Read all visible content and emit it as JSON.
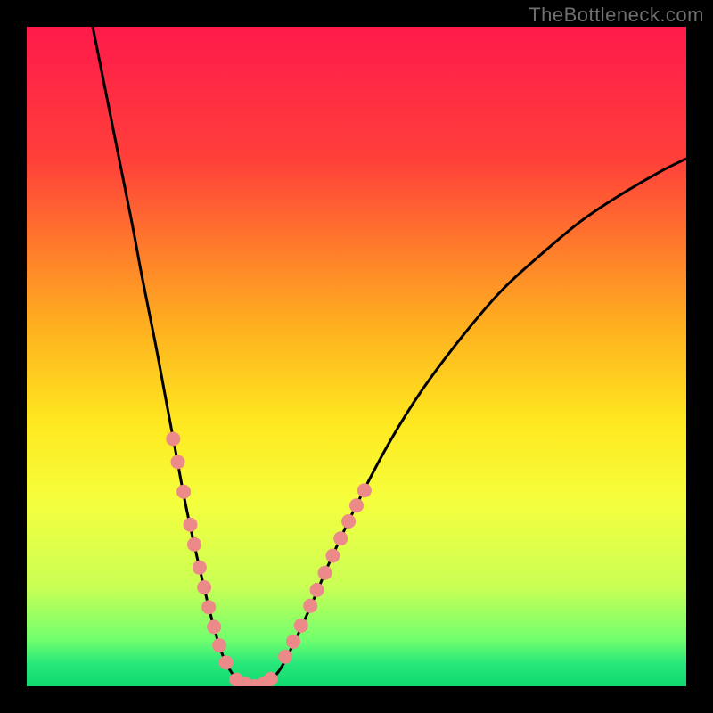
{
  "watermark": "TheBottleneck.com",
  "chart_data": {
    "type": "line",
    "title": "",
    "xlabel": "",
    "ylabel": "",
    "xlim": [
      0,
      100
    ],
    "ylim": [
      0,
      100
    ],
    "gradient_stops": [
      {
        "offset": 0.0,
        "color": "#ff1a4b"
      },
      {
        "offset": 0.2,
        "color": "#ff3f3a"
      },
      {
        "offset": 0.45,
        "color": "#ffae1f"
      },
      {
        "offset": 0.6,
        "color": "#ffe81f"
      },
      {
        "offset": 0.72,
        "color": "#f5ff3d"
      },
      {
        "offset": 0.85,
        "color": "#c9ff55"
      },
      {
        "offset": 0.93,
        "color": "#70ff6e"
      },
      {
        "offset": 0.965,
        "color": "#28e87a"
      },
      {
        "offset": 1.0,
        "color": "#0fd96f"
      }
    ],
    "series": [
      {
        "name": "left-curve",
        "type": "path",
        "points": [
          {
            "x": 10.0,
            "y": 100.0
          },
          {
            "x": 12.0,
            "y": 90.0
          },
          {
            "x": 14.0,
            "y": 80.0
          },
          {
            "x": 16.0,
            "y": 70.0
          },
          {
            "x": 17.5,
            "y": 62.0
          },
          {
            "x": 19.5,
            "y": 52.0
          },
          {
            "x": 21.0,
            "y": 44.0
          },
          {
            "x": 22.5,
            "y": 36.0
          },
          {
            "x": 24.0,
            "y": 28.0
          },
          {
            "x": 25.5,
            "y": 21.0
          },
          {
            "x": 27.0,
            "y": 14.5
          },
          {
            "x": 28.5,
            "y": 8.5
          },
          {
            "x": 30.0,
            "y": 4.0
          },
          {
            "x": 31.5,
            "y": 1.5
          },
          {
            "x": 33.0,
            "y": 0.3
          },
          {
            "x": 34.5,
            "y": 0.0
          }
        ]
      },
      {
        "name": "right-curve",
        "type": "path",
        "points": [
          {
            "x": 34.5,
            "y": 0.0
          },
          {
            "x": 36.0,
            "y": 0.3
          },
          {
            "x": 38.0,
            "y": 2.0
          },
          {
            "x": 40.0,
            "y": 5.5
          },
          {
            "x": 43.0,
            "y": 12.0
          },
          {
            "x": 46.0,
            "y": 19.0
          },
          {
            "x": 50.0,
            "y": 27.5
          },
          {
            "x": 55.0,
            "y": 37.0
          },
          {
            "x": 60.0,
            "y": 45.0
          },
          {
            "x": 66.0,
            "y": 53.0
          },
          {
            "x": 72.0,
            "y": 60.0
          },
          {
            "x": 78.0,
            "y": 65.5
          },
          {
            "x": 84.0,
            "y": 70.5
          },
          {
            "x": 90.0,
            "y": 74.5
          },
          {
            "x": 96.0,
            "y": 78.0
          },
          {
            "x": 100.0,
            "y": 80.0
          }
        ]
      }
    ],
    "marker_groups": [
      {
        "name": "left-dots",
        "points": [
          {
            "x": 22.2,
            "y": 37.5
          },
          {
            "x": 22.9,
            "y": 34.0
          },
          {
            "x": 23.8,
            "y": 29.5
          },
          {
            "x": 24.8,
            "y": 24.5
          },
          {
            "x": 25.4,
            "y": 21.5
          },
          {
            "x": 26.2,
            "y": 18.0
          },
          {
            "x": 26.9,
            "y": 15.0
          },
          {
            "x": 27.6,
            "y": 12.0
          },
          {
            "x": 28.4,
            "y": 9.0
          },
          {
            "x": 29.2,
            "y": 6.2
          },
          {
            "x": 30.2,
            "y": 3.6
          }
        ]
      },
      {
        "name": "bottom-dots",
        "points": [
          {
            "x": 31.8,
            "y": 1.0
          },
          {
            "x": 33.2,
            "y": 0.3
          },
          {
            "x": 34.5,
            "y": 0.0
          },
          {
            "x": 35.8,
            "y": 0.3
          },
          {
            "x": 37.0,
            "y": 1.1
          }
        ]
      },
      {
        "name": "right-dots",
        "points": [
          {
            "x": 39.2,
            "y": 4.5
          },
          {
            "x": 40.4,
            "y": 6.8
          },
          {
            "x": 41.6,
            "y": 9.2
          },
          {
            "x": 43.0,
            "y": 12.2
          },
          {
            "x": 44.0,
            "y": 14.6
          },
          {
            "x": 45.2,
            "y": 17.2
          },
          {
            "x": 46.4,
            "y": 19.8
          },
          {
            "x": 47.6,
            "y": 22.4
          },
          {
            "x": 48.8,
            "y": 25.0
          },
          {
            "x": 50.0,
            "y": 27.4
          },
          {
            "x": 51.2,
            "y": 29.7
          }
        ]
      }
    ]
  }
}
